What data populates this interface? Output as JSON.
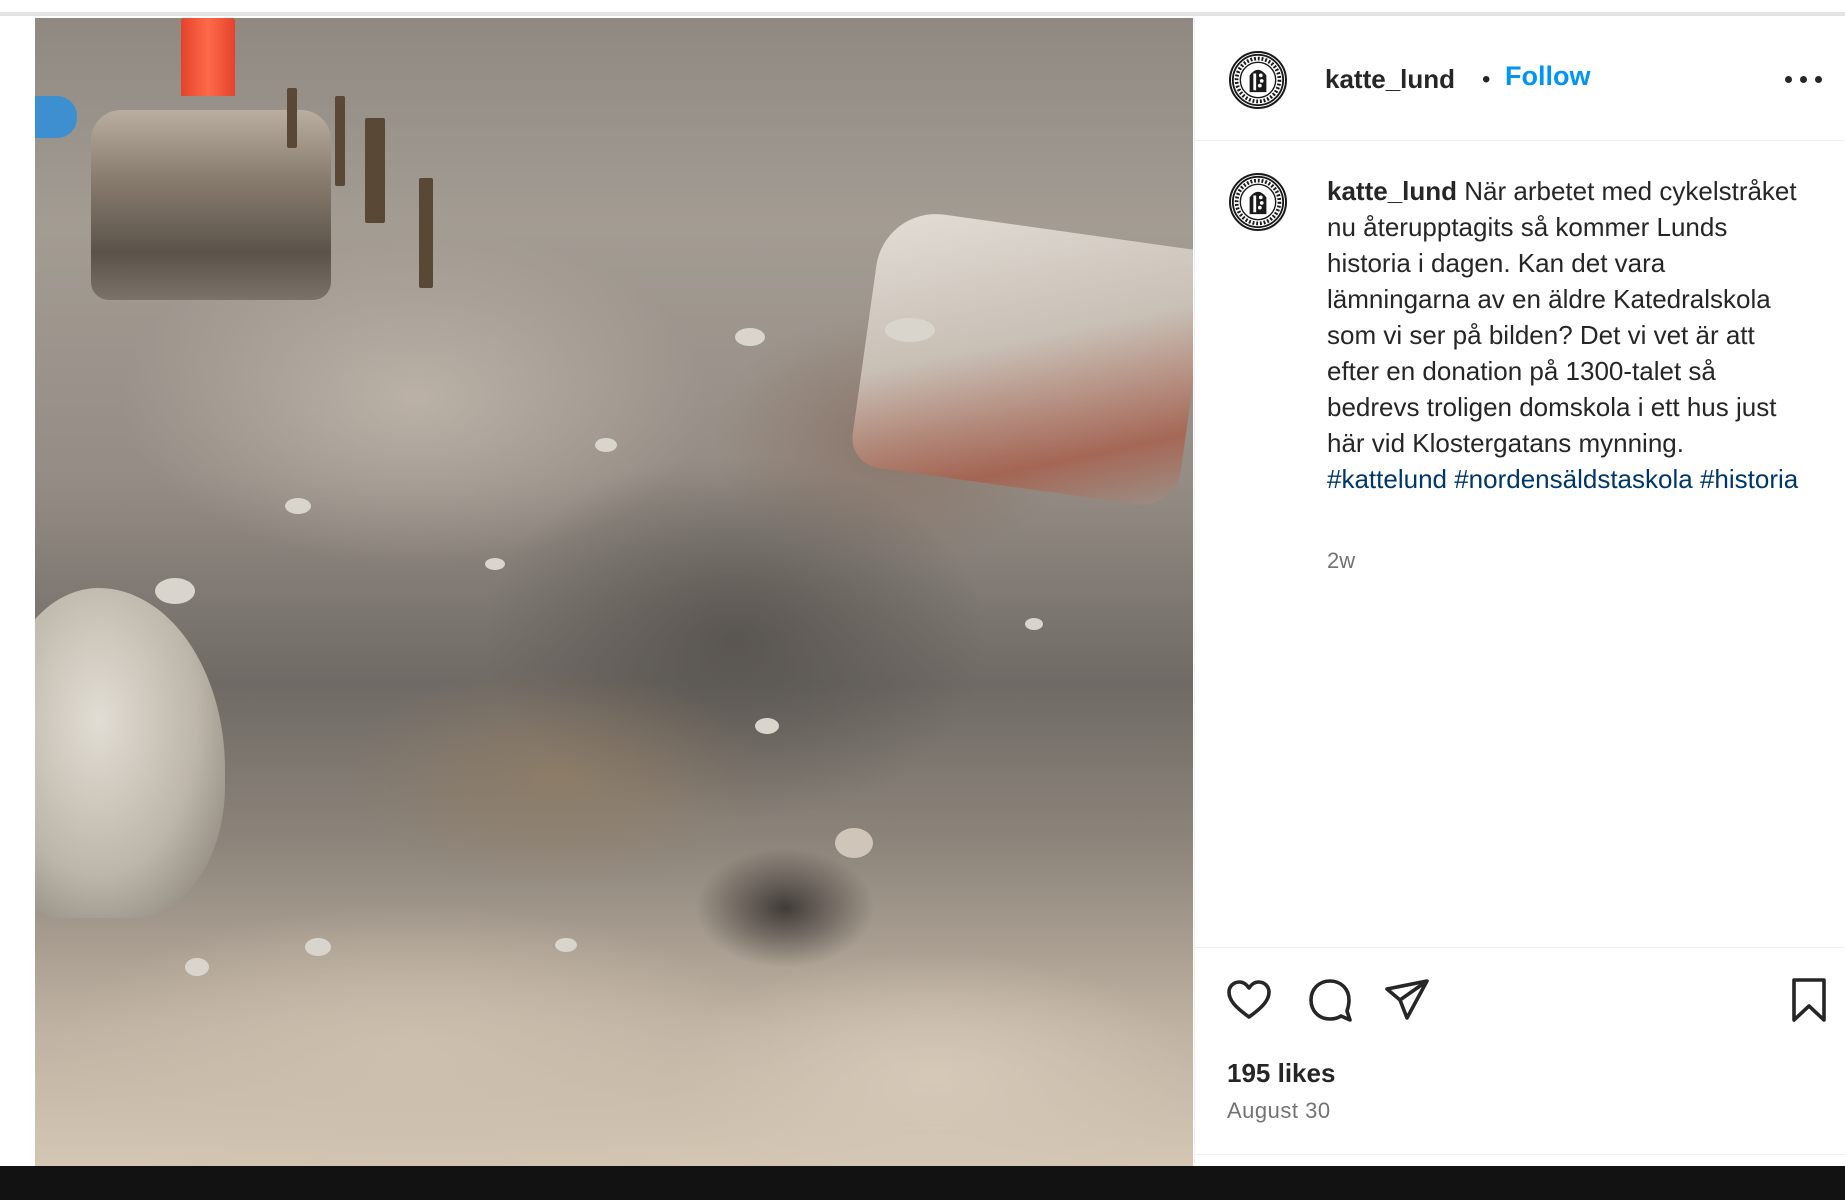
{
  "post": {
    "username": "katte_lund",
    "follow_label": "Follow",
    "separator": "•",
    "caption_text": "När arbetet med cykelstråket nu återupptagits så kommer Lunds historia i dagen. Kan det vara lämningarna av en äldre Katedralskola som vi ser på bilden? Det vi vet är att efter en donation på 1300-talet så bedrevs troligen domskola i ett hus just här vid Klostergatans mynning.",
    "hashtags": [
      "#kattelund",
      "#nordensäldstaskola",
      "#historia"
    ],
    "time_ago": "2w",
    "likes": "195 likes",
    "date": "August 30"
  },
  "icons": {
    "like": "heart-icon",
    "comment": "comment-icon",
    "share": "share-icon",
    "save": "bookmark-icon",
    "more": "more-options-icon"
  },
  "colors": {
    "follow": "#0095f6",
    "hashtag": "#00376b",
    "secondary_text": "#737373",
    "primary_text": "#262626"
  }
}
